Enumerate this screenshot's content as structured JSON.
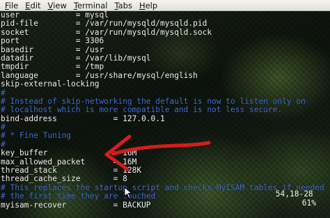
{
  "menu": [
    {
      "label": "File",
      "mnemonic": "F",
      "rest": "ile"
    },
    {
      "label": "Edit",
      "mnemonic": "E",
      "rest": "dit"
    },
    {
      "label": "View",
      "mnemonic": "V",
      "rest": "iew"
    },
    {
      "label": "Terminal",
      "mnemonic": "T",
      "rest": "erminal"
    },
    {
      "label": "Tabs",
      "mnemonic": "T",
      "rest": "abs"
    },
    {
      "label": "Help",
      "mnemonic": "H",
      "rest": "elp"
    }
  ],
  "editor": {
    "lines": [
      {
        "text": "user            = mysql",
        "comment": false
      },
      {
        "text": "pid-file        = /var/run/mysqld/mysqld.pid",
        "comment": false
      },
      {
        "text": "socket          = /var/run/mysqld/mysqld.sock",
        "comment": false
      },
      {
        "text": "port            = 3306",
        "comment": false
      },
      {
        "text": "basedir         = /usr",
        "comment": false
      },
      {
        "text": "datadir         = /var/lib/mysql",
        "comment": false
      },
      {
        "text": "tmpdir          = /tmp",
        "comment": false
      },
      {
        "text": "language        = /usr/share/mysql/english",
        "comment": false
      },
      {
        "text": "skip-external-locking",
        "comment": false
      },
      {
        "text": "#",
        "comment": true
      },
      {
        "text": "# Instead of skip-networking the default is now to listen only on",
        "comment": true
      },
      {
        "text": "# localhost which is more compatible and is not less secure.",
        "comment": true
      },
      {
        "text": "bind-address            = 127.0.0.1",
        "comment": false
      },
      {
        "text": "#",
        "comment": true
      },
      {
        "text": "# * Fine Tuning",
        "comment": true
      },
      {
        "text": "#",
        "comment": true
      },
      {
        "text": "key_buffer              = 16M",
        "comment": false
      },
      {
        "text": "max_allowed_packet      = 16M",
        "comment": false
      },
      {
        "text": "thread_stack            = 128K",
        "comment": false
      },
      {
        "text": "thread_cache_size       = 8",
        "comment": false
      },
      {
        "text": "# This replaces the startup script and checks MyISAM tables if needed",
        "comment": true
      },
      {
        "text": "# the first time they are touched",
        "comment": true
      },
      {
        "text": "myisam-recover          = BACKUP",
        "comment": false
      }
    ],
    "status_position": "54,18-28",
    "status_scroll": "61%"
  },
  "colors": {
    "text": "#f2f2f2",
    "comment": "#3f6fd6",
    "arrow": "#d81c1c"
  },
  "icons": [
    "red-arrow-annotation",
    "mouse-pointer-icon"
  ]
}
